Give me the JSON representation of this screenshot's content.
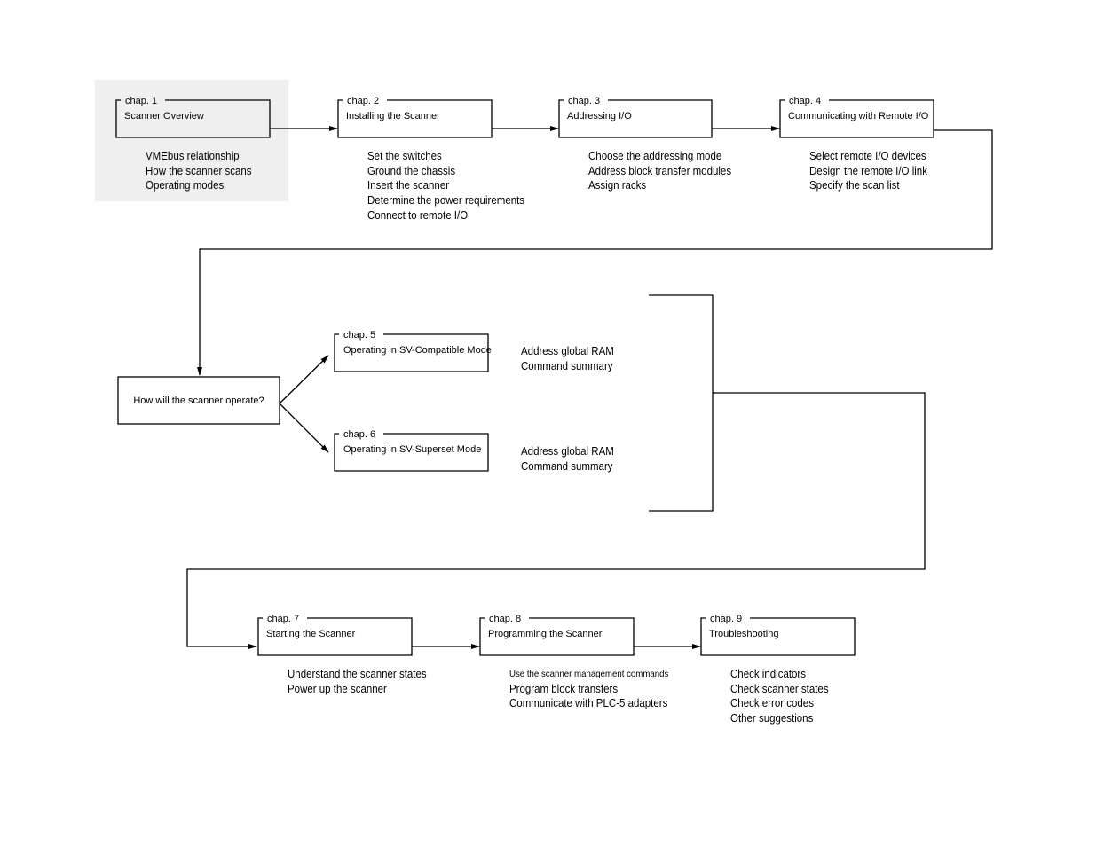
{
  "chapters": [
    {
      "chap": "chap. 1",
      "title": "Scanner Overview",
      "items": [
        "VMEbus relationship",
        "How the scanner scans",
        "Operating modes"
      ]
    },
    {
      "chap": "chap. 2",
      "title": "Installing the Scanner",
      "items": [
        "Set the switches",
        "Ground the chassis",
        "Insert the scanner",
        "Determine the power requirements",
        "Connect to remote I/O"
      ]
    },
    {
      "chap": "chap. 3",
      "title": "Addressing I/O",
      "items": [
        "Choose the addressing mode",
        "Address block transfer modules",
        "Assign racks"
      ]
    },
    {
      "chap": "chap. 4",
      "title": "Communicating with Remote I/O",
      "items": [
        "Select remote I/O devices",
        "Design the remote I/O link",
        "Specify the scan list"
      ]
    },
    {
      "chap": "chap. 5",
      "title": "Operating in SV-Compatible Mode",
      "items": [
        "Address global RAM",
        "Command summary"
      ]
    },
    {
      "chap": "chap. 6",
      "title": "Operating in SV-Superset Mode",
      "items": [
        "Address global RAM",
        "Command summary"
      ]
    },
    {
      "chap": "chap. 7",
      "title": "Starting the Scanner",
      "items": [
        "Understand the scanner states",
        "Power up the scanner"
      ]
    },
    {
      "chap": "chap. 8",
      "title": "Programming the Scanner",
      "items": [
        "Use the scanner management commands",
        "Program block transfers",
        "Communicate with PLC-5 adapters"
      ]
    },
    {
      "chap": "chap. 9",
      "title": "Troubleshooting",
      "items": [
        "Check indicators",
        "Check scanner states",
        "Check error codes",
        "Other suggestions"
      ]
    }
  ],
  "decision": "How will the scanner operate?",
  "colors": {
    "highlight": "#efefef",
    "line": "#000000"
  }
}
